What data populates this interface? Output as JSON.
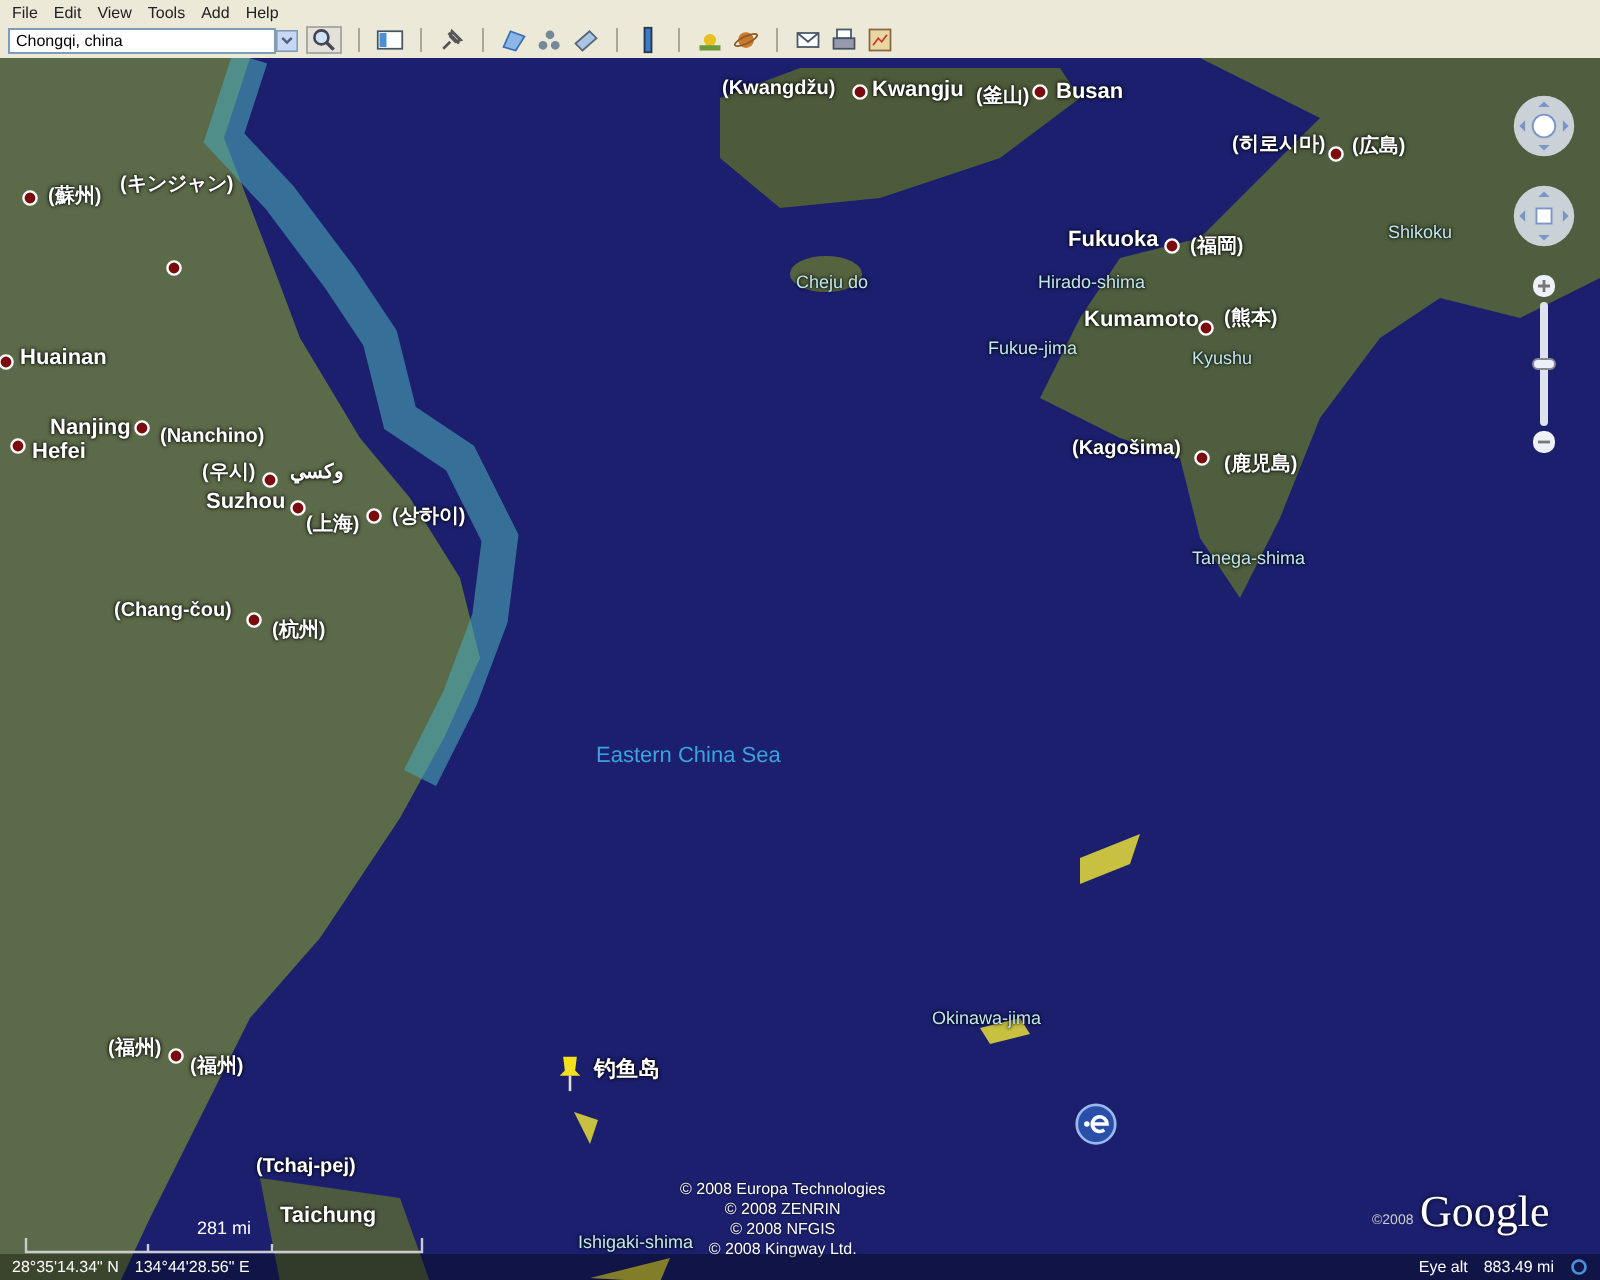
{
  "menu": [
    "File",
    "Edit",
    "View",
    "Tools",
    "Add",
    "Help"
  ],
  "search": {
    "value": "Chongqi, china"
  },
  "map_labels": [
    {
      "text": "(Kwangdžu)",
      "kind": "place"
    },
    {
      "text": "Kwangju",
      "kind": "city"
    },
    {
      "text": "(釜山)",
      "kind": "place"
    },
    {
      "text": "Busan",
      "kind": "city"
    },
    {
      "text": "(蘇州)",
      "kind": "place"
    },
    {
      "text": "(キンジャン)",
      "kind": "place"
    },
    {
      "text": "Huainan",
      "kind": "city"
    },
    {
      "text": "Nanjing",
      "kind": "city"
    },
    {
      "text": "(Nanchino)",
      "kind": "place"
    },
    {
      "text": "Hefei",
      "kind": "city"
    },
    {
      "text": "(우시)",
      "kind": "place"
    },
    {
      "text": "وكسي",
      "kind": "place"
    },
    {
      "text": "Suzhou",
      "kind": "city"
    },
    {
      "text": "(上海)",
      "kind": "place"
    },
    {
      "text": "(상하이)",
      "kind": "place"
    },
    {
      "text": "(Chang-čou)",
      "kind": "place"
    },
    {
      "text": "(杭州)",
      "kind": "place"
    },
    {
      "text": "Cheju do",
      "kind": "island"
    },
    {
      "text": "(히로시마)",
      "kind": "place"
    },
    {
      "text": "(広島)",
      "kind": "place"
    },
    {
      "text": "Shikoku",
      "kind": "island"
    },
    {
      "text": "Fukuoka",
      "kind": "city"
    },
    {
      "text": "(福岡)",
      "kind": "place"
    },
    {
      "text": "Hirado-shima",
      "kind": "island"
    },
    {
      "text": "Kumamoto",
      "kind": "city"
    },
    {
      "text": "(熊本)",
      "kind": "place"
    },
    {
      "text": "Fukue-jima",
      "kind": "island"
    },
    {
      "text": "Kyushu",
      "kind": "island"
    },
    {
      "text": "(Kagošima)",
      "kind": "place"
    },
    {
      "text": "(鹿児島)",
      "kind": "place"
    },
    {
      "text": "Tanega-shima",
      "kind": "island"
    },
    {
      "text": "Eastern China Sea",
      "kind": "sea"
    },
    {
      "text": "Okinawa-jima",
      "kind": "island"
    },
    {
      "text": "钓鱼岛",
      "kind": "placemark"
    },
    {
      "text": "(福州)",
      "kind": "place"
    },
    {
      "text": "(福州)",
      "kind": "place"
    },
    {
      "text": "(Tchaj-pej)",
      "kind": "place"
    },
    {
      "text": "Taichung",
      "kind": "city"
    },
    {
      "text": "Ishigaki-shima",
      "kind": "island"
    }
  ],
  "zoom": {
    "level": 0.5
  },
  "scale": "281 mi",
  "copyright": [
    "© 2008 Europa Technologies",
    "© 2008 ZENRIN",
    "© 2008 NFGIS",
    "© 2008 Kingway Ltd."
  ],
  "status": {
    "latitude": "28°35'14.34\" N",
    "longitude": "134°44'28.56\" E",
    "eye_alt_label": "Eye alt",
    "eye_alt": "883.49 mi"
  },
  "logo_year": "©2008",
  "logo": "Google"
}
